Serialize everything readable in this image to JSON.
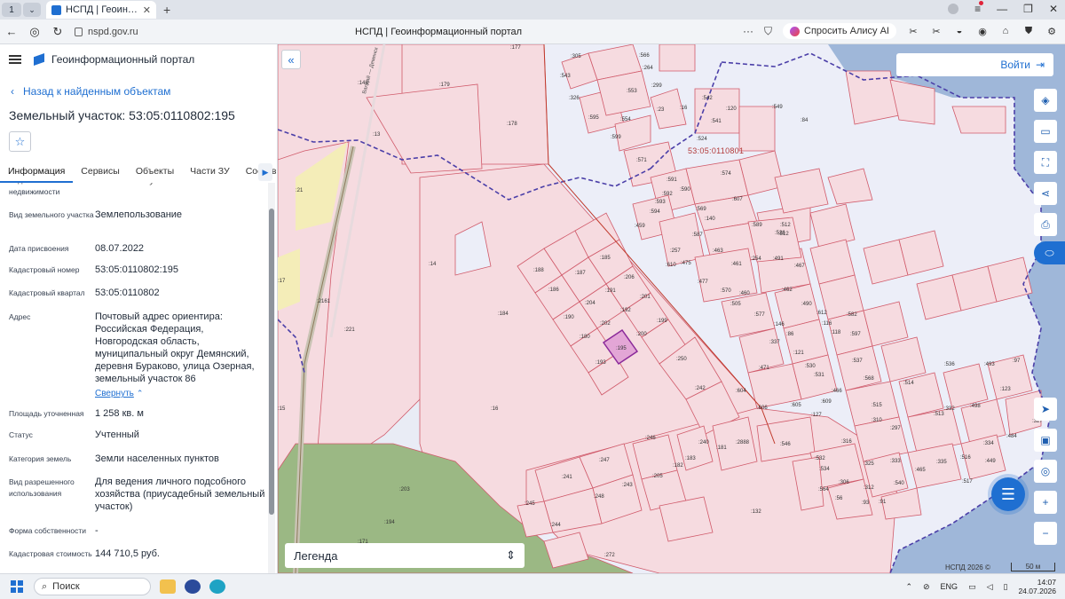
{
  "browser": {
    "tab_count": "1",
    "tab_title": "НСПД | Геоинформаци",
    "url": "nspd.gov.ru",
    "page_title": "НСПД | Геоинформационный портал",
    "alisa_label": "Спросить Алису AI"
  },
  "panel": {
    "app_title": "Геоинформационный портал",
    "back_label": "Назад к найденным объектам",
    "title": "Земельный участок: 53:05:0110802:195",
    "tabs": [
      "Информация",
      "Сервисы",
      "Объекты",
      "Части ЗУ",
      "Состав"
    ],
    "collapse_label": "Свернуть",
    "fields": [
      {
        "key": "Вид объекта недвижимости",
        "value": "Земельный участок"
      },
      {
        "key": "Вид земельного участка",
        "value": "Землепользование"
      },
      {
        "key": "Дата присвоения",
        "value": "08.07.2022"
      },
      {
        "key": "Кадастровый номер",
        "value": "53:05:0110802:195"
      },
      {
        "key": "Кадастровый квартал",
        "value": "53:05:0110802"
      },
      {
        "key": "Адрес",
        "value": "Почтовый адрес ориентира: Российская Федерация, Новгородская область, муниципальный округ Демянский, деревня Бураково, улица Озерная, земельный участок 86"
      },
      {
        "key": "Площадь уточненная",
        "value": "1 258 кв. м"
      },
      {
        "key": "Статус",
        "value": "Учтенный"
      },
      {
        "key": "Категория земель",
        "value": "Земли населенных пунктов"
      },
      {
        "key": "Вид разрешенного использования",
        "value": "Для ведения личного подсобного хозяйства (приусадебный земельный участок)"
      },
      {
        "key": "Форма собственности",
        "value": "-"
      },
      {
        "key": "Кадастровая стоимость",
        "value": "144 710,5 руб."
      }
    ]
  },
  "map": {
    "login_label": "Войти",
    "legend_label": "Легенда",
    "quarter_label": "53:05:0110801",
    "copyright": "НСПД 2026 ©",
    "scale_label": "50 м",
    "parcels": [
      {
        "label": ":195",
        "selected": true
      },
      ":177",
      ":148",
      ":179",
      ":178",
      ":13",
      ":21",
      ":17",
      ":14",
      ":2161",
      ":221",
      ":184",
      ":16",
      ":15",
      ":203",
      ":194",
      ":171",
      ":188",
      ":186",
      ":187",
      ":185",
      ":206",
      ":191",
      ":204",
      ":201",
      ":190",
      ":202",
      ":192",
      ":199",
      ":180",
      ":200",
      ":193",
      ":250",
      ":242",
      ":246",
      ":247",
      ":241",
      ":248",
      ":243",
      ":205",
      ":245",
      ":244",
      ":272",
      ":182",
      ":183",
      ":240",
      ":181",
      ":2888",
      ":546",
      ":132",
      ":305",
      ":543",
      ":326",
      ":595",
      ":599",
      ":566",
      ":264",
      ":299",
      ":553",
      ":554",
      ":23",
      ":16",
      ":542",
      ":120",
      ":541",
      ":524",
      ":549",
      ":84",
      ":571",
      ":574",
      ":607",
      ":591",
      ":592",
      ":593",
      ":590",
      ":594",
      ":569",
      ":459",
      ":140",
      ":587",
      ":589",
      ":512",
      ":526",
      ":257",
      ":610",
      ":475",
      ":463",
      ":461",
      ":254",
      ":491",
      ":467",
      ":477",
      ":570",
      ":460",
      ":505",
      ":462",
      ":490",
      ":577",
      ":146",
      ":86",
      ":337",
      ":121",
      ":530",
      ":531",
      ":612",
      ":116",
      ":118",
      ":582",
      ":597",
      ":537",
      ":471",
      ":604",
      ":606",
      ":605",
      ":609",
      ":466",
      ":127",
      ":568",
      ":515",
      ":310",
      ":297",
      ":514",
      ":536",
      ":493",
      ":97",
      ":123",
      ":498",
      ":332",
      ":513",
      ":327",
      ":316",
      ":532",
      ":534",
      ":564",
      ":306",
      ":325",
      ":312",
      ":56",
      ":93",
      ":91",
      ":333",
      ":540",
      ":465",
      ":335",
      ":516",
      ":334",
      ":517",
      ":449",
      ":484",
      ":512"
    ],
    "road_labels": [
      "Валдай — Демянск"
    ]
  },
  "taskbar": {
    "search_label": "Поиск",
    "lang": "ENG",
    "time": "14:07",
    "date": "24.07.2026"
  },
  "colors": {
    "accent": "#1f6fd1",
    "parcel_fill": "#f6dbe0",
    "parcel_stroke": "#d05a6a",
    "selected_fill": "#e3a6d6",
    "selected_stroke": "#8b2a9a",
    "water": "#9fb7d9",
    "forest": "#9bb884",
    "quarter_border": "#4b3fa8"
  }
}
